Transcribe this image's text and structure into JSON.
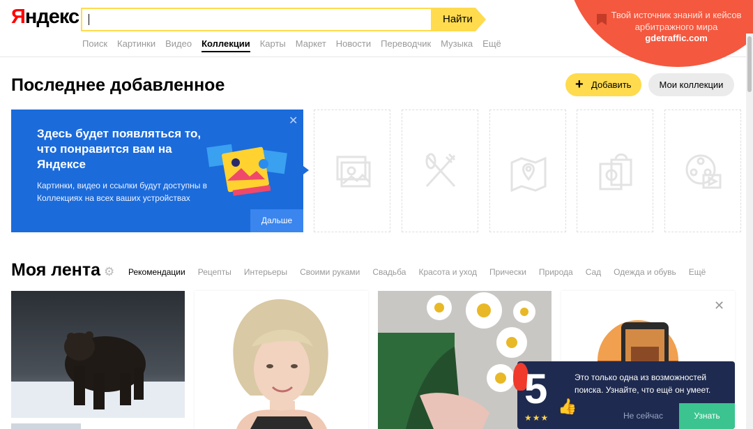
{
  "header": {
    "logo_first": "Я",
    "logo_rest": "ндекс",
    "search_button": "Найти",
    "search_value": "",
    "nav": [
      "Поиск",
      "Картинки",
      "Видео",
      "Коллекции",
      "Карты",
      "Маркет",
      "Новости",
      "Переводчик",
      "Музыка",
      "Ещё"
    ],
    "nav_active_index": 3
  },
  "promo": {
    "text": "Твой источник знаний и кейсов арбитражного мира",
    "link": "gdetraffic.com"
  },
  "recent": {
    "title": "Последнее добавленное",
    "add_button": "Добавить",
    "my_collections_button": "Мои коллекции"
  },
  "banner": {
    "title": "Здесь будет появляться то, что понравится вам на Яндексе",
    "description": "Картинки, видео и ссылки будут доступны в Коллекциях на всех ваших устройствах",
    "next_button": "Дальше"
  },
  "placeholders": [
    "images-icon",
    "food-icon",
    "travel-icon",
    "shopping-icon",
    "video-icon"
  ],
  "feed": {
    "title": "Моя лента",
    "tags": [
      "Рекомендации",
      "Рецепты",
      "Интерьеры",
      "Своими руками",
      "Свадьба",
      "Красота и уход",
      "Прически",
      "Природа",
      "Сад",
      "Одежда и обувь",
      "Ещё"
    ],
    "selected_tag_index": 0
  },
  "popup": {
    "badge_number": "5",
    "text": "Это только одна из возможностей поиска. Узнайте, что ещё он умеет.",
    "later_button": "Не сейчас",
    "learn_button": "Узнать"
  },
  "colors": {
    "accent_yellow": "#ffdb4d",
    "banner_blue": "#1b6bdb",
    "promo_red": "#f4583f",
    "popup_navy": "#1e2a4f",
    "learn_green": "#3bc48f"
  }
}
